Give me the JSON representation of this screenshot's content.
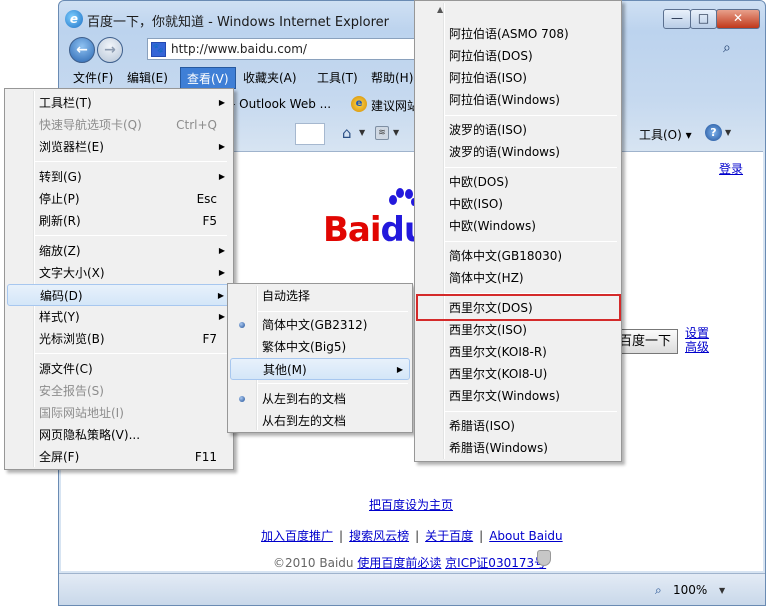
{
  "window": {
    "title": "百度一下，你就知道 - Windows Internet Explorer",
    "min_btn": "—",
    "max_btn": "□",
    "close_btn": "✕"
  },
  "address": {
    "url": "http://www.baidu.com/"
  },
  "menubar": {
    "items": [
      {
        "label": "文件(F)"
      },
      {
        "label": "编辑(E)"
      },
      {
        "label": "查看(V)"
      },
      {
        "label": "收藏夹(A)"
      },
      {
        "label": "工具(T)"
      },
      {
        "label": "帮助(H)"
      }
    ]
  },
  "favorites": {
    "outlook": "- Outlook Web ...",
    "suggest": "建议网站"
  },
  "commandbar": {
    "tools": "工具(O) ▾"
  },
  "view_menu": {
    "items": [
      {
        "label": "工具栏(T)",
        "shortcut": "",
        "arrow": "▶"
      },
      {
        "label": "快速导航选项卡(Q)",
        "shortcut": "Ctrl+Q",
        "arrow": ""
      },
      {
        "label": "浏览器栏(E)",
        "shortcut": "",
        "arrow": "▶"
      },
      {
        "label": "转到(G)",
        "shortcut": "",
        "arrow": "▶"
      },
      {
        "label": "停止(P)",
        "shortcut": "Esc",
        "arrow": ""
      },
      {
        "label": "刷新(R)",
        "shortcut": "F5",
        "arrow": ""
      },
      {
        "label": "缩放(Z)",
        "shortcut": "",
        "arrow": "▶"
      },
      {
        "label": "文字大小(X)",
        "shortcut": "",
        "arrow": "▶"
      },
      {
        "label": "编码(D)",
        "shortcut": "",
        "arrow": "▶"
      },
      {
        "label": "样式(Y)",
        "shortcut": "",
        "arrow": "▶"
      },
      {
        "label": "光标浏览(B)",
        "shortcut": "F7",
        "arrow": ""
      },
      {
        "label": "源文件(C)",
        "shortcut": "",
        "arrow": ""
      },
      {
        "label": "安全报告(S)",
        "shortcut": "",
        "arrow": ""
      },
      {
        "label": "国际网站地址(I)",
        "shortcut": "",
        "arrow": ""
      },
      {
        "label": "网页隐私策略(V)...",
        "shortcut": "",
        "arrow": ""
      },
      {
        "label": "全屏(F)",
        "shortcut": "F11",
        "arrow": ""
      }
    ]
  },
  "encoding_menu": {
    "items": [
      {
        "label": "自动选择"
      },
      {
        "label": "简体中文(GB2312)"
      },
      {
        "label": "繁体中文(Big5)"
      },
      {
        "label": "其他(M)",
        "arrow": "▶"
      },
      {
        "label": "从左到右的文档"
      },
      {
        "label": "从右到左的文档"
      }
    ]
  },
  "more_menu": {
    "items": [
      {
        "label": "阿拉伯语(ASMO 708)"
      },
      {
        "label": "阿拉伯语(DOS)"
      },
      {
        "label": "阿拉伯语(ISO)"
      },
      {
        "label": "阿拉伯语(Windows)"
      },
      {
        "label": "波罗的语(ISO)"
      },
      {
        "label": "波罗的语(Windows)"
      },
      {
        "label": "中欧(DOS)"
      },
      {
        "label": "中欧(ISO)"
      },
      {
        "label": "中欧(Windows)"
      },
      {
        "label": "简体中文(GB18030)"
      },
      {
        "label": "简体中文(HZ)"
      },
      {
        "label": "西里尔文(DOS)"
      },
      {
        "label": "西里尔文(ISO)"
      },
      {
        "label": "西里尔文(KOI8-R)"
      },
      {
        "label": "西里尔文(KOI8-U)"
      },
      {
        "label": "西里尔文(Windows)"
      },
      {
        "label": "希腊语(ISO)"
      },
      {
        "label": "希腊语(Windows)"
      }
    ]
  },
  "page": {
    "login": "登录",
    "logo_bai": "Bai",
    "logo_du": "du",
    "search_button": "百度一下",
    "settings": "设置",
    "advanced": "高级",
    "set_homepage": "把百度设为主页",
    "footer": {
      "link1": "加入百度推广",
      "link2": "搜索风云榜",
      "link3": "关于百度",
      "link4": "About Baidu",
      "sep": "|"
    },
    "copyright_prefix": "©2010 Baidu ",
    "copyright_link1": "使用百度前必读",
    "copyright_link2": "京ICP证030173号"
  },
  "status": {
    "zoom": "100%"
  },
  "colors": {
    "highlight_border": "#d42a2a",
    "menu_active": "#3f7fd6",
    "link": "#0000cc"
  }
}
